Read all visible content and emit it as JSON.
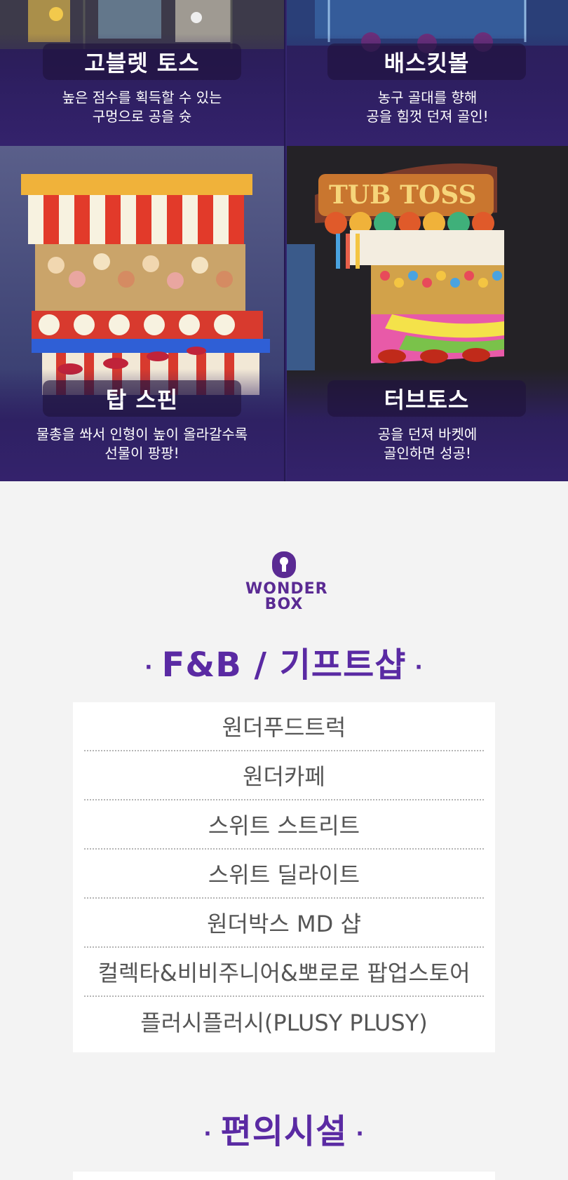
{
  "games": [
    {
      "title": "고블렛 토스",
      "desc_line1": "높은 점수를 획득할 수 있는",
      "desc_line2": "구멍으로 공을 슛"
    },
    {
      "title": "배스킷볼",
      "desc_line1": "농구 골대를 향해",
      "desc_line2": "공을 힘껏 던져 골인!"
    },
    {
      "title": "탑 스핀",
      "desc_line1": "물총을 쏴서 인형이 높이 올라갈수록",
      "desc_line2": "선물이 팡팡!"
    },
    {
      "title": "터브토스",
      "desc_line1": "공을 던져 바켓에",
      "desc_line2": "골인하면 성공!"
    }
  ],
  "brand": {
    "line1": "WONDER",
    "line2": "BOX",
    "color": "#5a2a93"
  },
  "fnb": {
    "title": "F&B / 기프트샵",
    "items": [
      "원더푸드트럭",
      "원더카페",
      "스위트 스트리트",
      "스위트 딜라이트",
      "원더박스 MD 샵",
      "컬렉타&비비주니어&뽀로로 팝업스토어",
      "플러시플러시(PLUSY PLUSY)"
    ]
  },
  "facilities": {
    "title": "편의시설"
  },
  "colors": {
    "accent": "#5a2aa3",
    "panel": "#2e1f62"
  }
}
